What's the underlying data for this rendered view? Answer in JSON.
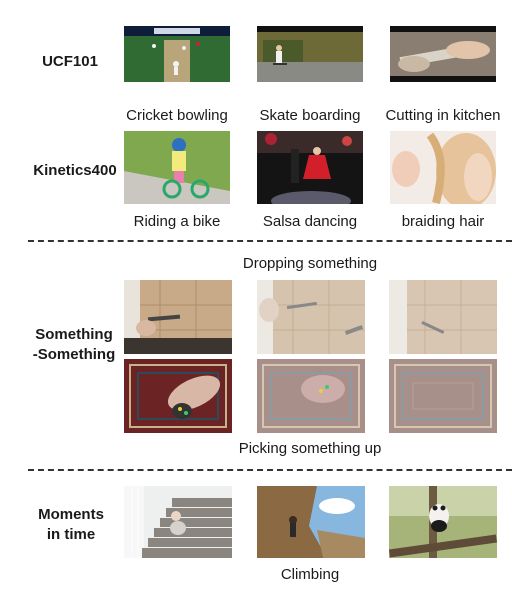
{
  "sections": {
    "ucf101": {
      "label": "UCF101",
      "captions": [
        "Cricket bowling",
        "Skate boarding",
        "Cutting in kitchen"
      ]
    },
    "kinetics400": {
      "label": "Kinetics400",
      "captions": [
        "Riding a bike",
        "Salsa dancing",
        "braiding hair"
      ]
    },
    "something_something": {
      "label_line1": "Something",
      "label_line2": "-Something",
      "caption_top": "Dropping something",
      "caption_bottom": "Picking something up"
    },
    "moments_in_time": {
      "label_line1": "Moments",
      "label_line2": "in time",
      "caption": "Climbing"
    }
  },
  "image_descriptions": {
    "ucf_1": "cricket-field-scene",
    "ucf_2": "skateboarder-outdoors",
    "ucf_3": "hand-cutting-food",
    "kin_1": "child-on-bike",
    "kin_2": "dancers-on-stage",
    "kin_3": "braided-hair",
    "ss_drop_1": "hand-holding-pen-over-floor",
    "ss_drop_2": "pen-falling-blurred",
    "ss_drop_3": "pen-on-floor",
    "ss_pick_1": "hand-picking-object-from-rug",
    "ss_pick_2": "blurred-hand-over-rug",
    "ss_pick_3": "empty-rug",
    "mit_1": "child-climbing-stairs",
    "mit_2": "person-climbing-rock",
    "mit_3": "panda-climbing-tree"
  }
}
